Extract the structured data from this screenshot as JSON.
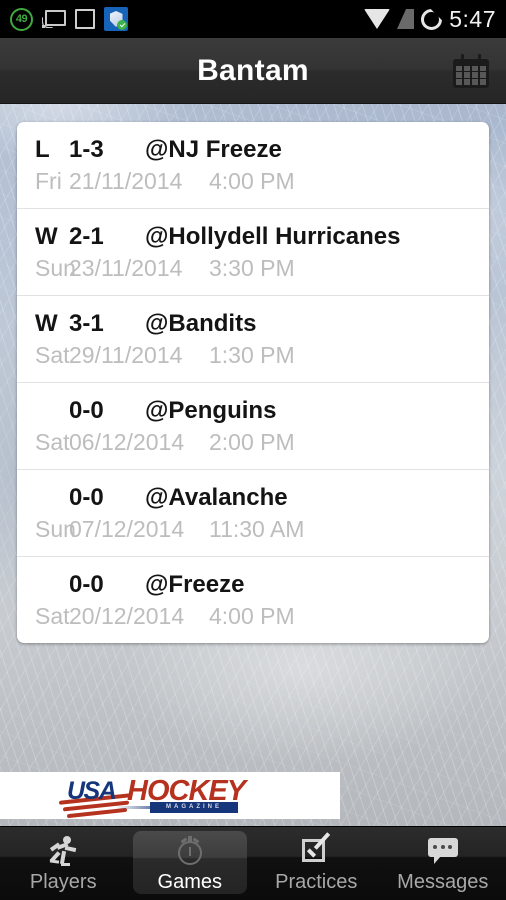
{
  "status_bar": {
    "download_badge": "49",
    "time": "5:47",
    "icons": [
      "download-progress-icon",
      "cast-icon",
      "square-icon",
      "security-shield-icon",
      "wifi-icon",
      "cellular-signal-icon",
      "battery-icon"
    ]
  },
  "header": {
    "title": "Bantam",
    "calendar_label": "calendar-icon"
  },
  "games": [
    {
      "result": "L",
      "score": "1-3",
      "opponent": "@NJ Freeze",
      "day": "Fri",
      "date": "21/11/2014",
      "time": "4:00 PM"
    },
    {
      "result": "W",
      "score": "2-1",
      "opponent": "@Hollydell Hurricanes",
      "day": "Sun",
      "date": "23/11/2014",
      "time": "3:30 PM"
    },
    {
      "result": "W",
      "score": "3-1",
      "opponent": "@Bandits",
      "day": "Sat",
      "date": "29/11/2014",
      "time": "1:30 PM"
    },
    {
      "result": "",
      "score": "0-0",
      "opponent": "@Penguins",
      "day": "Sat",
      "date": "06/12/2014",
      "time": "2:00 PM"
    },
    {
      "result": "",
      "score": "0-0",
      "opponent": "@Avalanche",
      "day": "Sun",
      "date": "07/12/2014",
      "time": "11:30 AM"
    },
    {
      "result": "",
      "score": "0-0",
      "opponent": "@Freeze",
      "day": "Sat",
      "date": "20/12/2014",
      "time": "4:00 PM"
    }
  ],
  "ad": {
    "brand_usa": "USA",
    "brand_hockey": "HOCKEY",
    "brand_sub": "MAGAZINE"
  },
  "tabs": [
    {
      "label": "Players",
      "icon": "runner-icon",
      "selected": false
    },
    {
      "label": "Games",
      "icon": "stopwatch-icon",
      "selected": true
    },
    {
      "label": "Practices",
      "icon": "checkbox-icon",
      "selected": false
    },
    {
      "label": "Messages",
      "icon": "speech-bubble-icon",
      "selected": false
    }
  ],
  "colors": {
    "header_bg": "#333333",
    "card_bg": "#ffffff",
    "primary_text": "#141414",
    "secondary_text": "#bdbdbd",
    "tabbar_bg": "#0b0b0b",
    "accent_green": "#3faa3f",
    "ad_blue": "#15367a",
    "ad_red": "#b5321f"
  }
}
